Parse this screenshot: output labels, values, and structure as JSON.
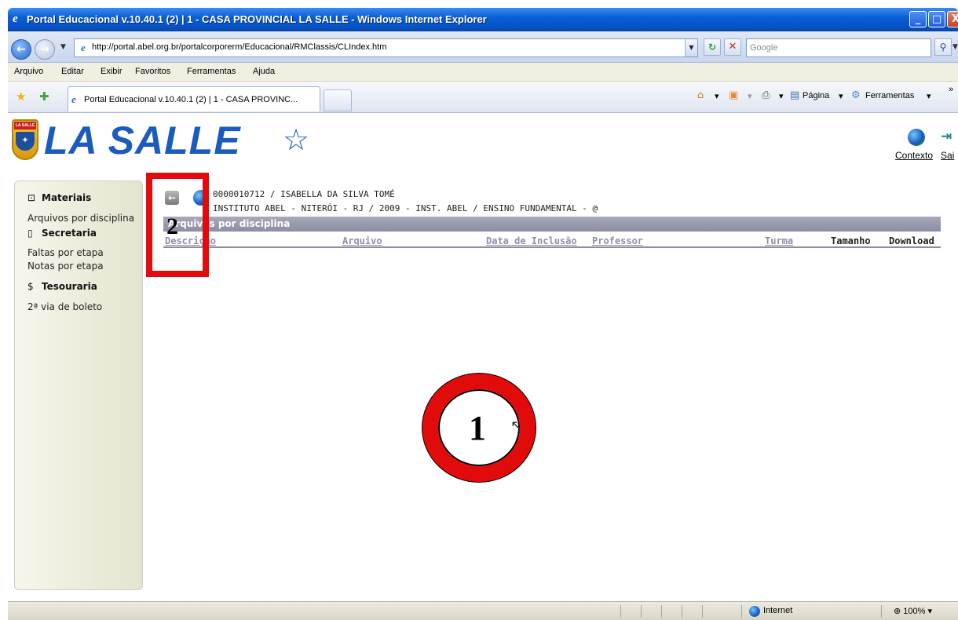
{
  "window": {
    "title": "Portal Educacional v.10.40.1 (2) | 1 - CASA PROVINCIAL LA SALLE - Windows Internet Explorer",
    "min": "_",
    "max": "□",
    "close": "X"
  },
  "address_bar": {
    "url": "http://portal.abel.org.br/portalcorporerm/Educacional/RMClassis/CLIndex.htm",
    "search_placeholder": "Google"
  },
  "menu": [
    "Arquivo",
    "Editar",
    "Exibir",
    "Favoritos",
    "Ferramentas",
    "Ajuda"
  ],
  "tab": {
    "label": "Portal Educacional v.10.40.1 (2) | 1 - CASA PROVINC..."
  },
  "toolbar": {
    "page": "Página",
    "tools": "Ferramentas"
  },
  "logo": {
    "text": "LA SALLE",
    "shield_text": "LA SALLE"
  },
  "header_links": {
    "context": "Contexto",
    "exit": "Sai"
  },
  "sidebar": {
    "sections": [
      {
        "title": "Materiais",
        "icon": "briefcase-icon",
        "items": [
          "Arquivos por disciplina"
        ]
      },
      {
        "title": "Secretaria",
        "icon": "clipboard-icon",
        "items": [
          "Faltas por etapa",
          "Notas por etapa"
        ]
      },
      {
        "title": "Tesouraria",
        "icon": "dollar-icon",
        "items": [
          "2ª via de boleto"
        ]
      }
    ]
  },
  "content": {
    "student": "0000010712  / ISABELLA DA SILVA TOMÉ",
    "institution": "INSTITUTO ABEL - NITERÓI - RJ / 2009 - INST. ABEL  / ENSINO FUNDAMENTAL - @",
    "grid_title": "Arquivos por disciplina",
    "columns": [
      "Descrição",
      "Arquivo",
      "Data de Inclusão",
      "Professor",
      "Turma",
      "Tamanho",
      "Download"
    ]
  },
  "annotations": {
    "box_number": "2",
    "circle_number": "1",
    "color": "#e10b0b"
  },
  "status_bar": {
    "zone": "Internet",
    "zoom": "100%"
  }
}
